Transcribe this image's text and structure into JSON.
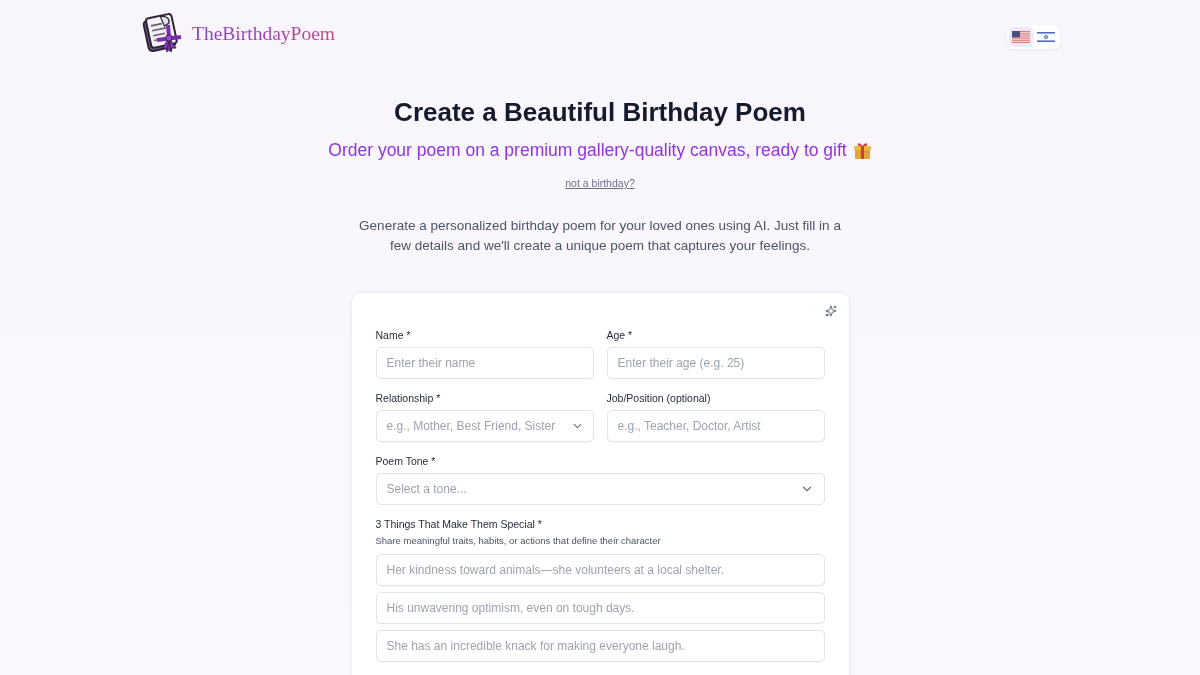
{
  "header": {
    "logo_text": "TheBirthdayPoem",
    "languages": [
      {
        "kind": "us",
        "selected": true
      },
      {
        "kind": "israel",
        "selected": false
      }
    ]
  },
  "hero": {
    "title": "Create a Beautiful Birthday Poem",
    "subtitle": "Order your poem on a premium gallery-quality canvas, ready to gift",
    "alt_link": "not a birthday?",
    "intro": "Generate a personalized birthday poem for your loved ones using AI. Just fill in a few details and we'll create a unique poem that captures your feelings."
  },
  "form": {
    "rows": [
      [
        {
          "kind": "input",
          "label": "Name *",
          "placeholder": "Enter their name"
        },
        {
          "kind": "input",
          "label": "Age *",
          "placeholder": "Enter their age (e.g. 25)"
        }
      ],
      [
        {
          "kind": "combo",
          "label": "Relationship *",
          "placeholder": "e.g., Mother, Best Friend, Sister"
        },
        {
          "kind": "input",
          "label": "Job/Position (optional)",
          "placeholder": "e.g., Teacher, Doctor, Artist"
        }
      ],
      [
        {
          "kind": "select",
          "label": "Poem Tone *",
          "placeholder": "Select a tone..."
        }
      ]
    ],
    "special": {
      "label": "3 Things That Make Them Special *",
      "hint": "Share meaningful traits, habits, or actions that define their character",
      "inputs": [
        {
          "placeholder": "Her kindness toward animals—she volunteers at a local shelter."
        },
        {
          "placeholder": "His unwavering optimism, even on tough days."
        },
        {
          "placeholder": "She has an incredible knack for making everyone laugh."
        }
      ]
    }
  }
}
